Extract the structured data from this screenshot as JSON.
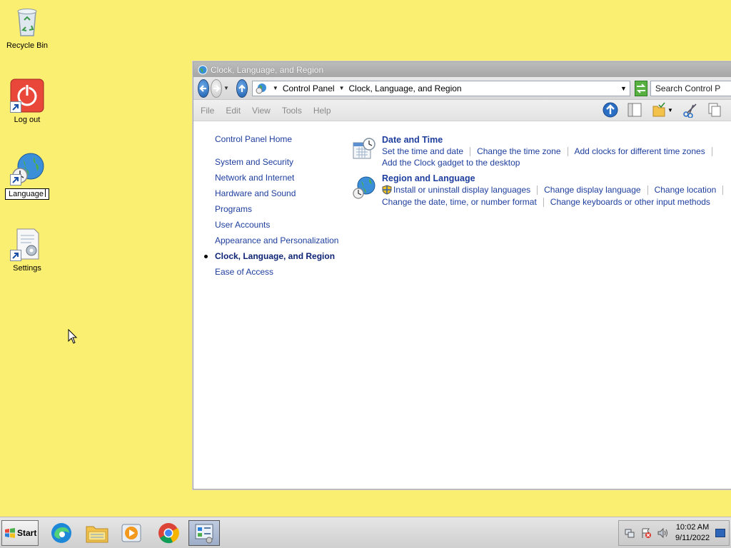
{
  "desktop": {
    "icons": [
      {
        "label": "Recycle Bin"
      },
      {
        "label": "Log out"
      },
      {
        "label": "Language"
      },
      {
        "label": "Settings"
      }
    ]
  },
  "window": {
    "title": "Clock, Language, and Region",
    "address": {
      "crumbs": [
        "Control Panel",
        "Clock, Language, and Region"
      ]
    },
    "search_placeholder": "Search Control P",
    "menu": [
      "File",
      "Edit",
      "View",
      "Tools",
      "Help"
    ],
    "sidebar": {
      "home": "Control Panel Home",
      "items": [
        "System and Security",
        "Network and Internet",
        "Hardware and Sound",
        "Programs",
        "User Accounts",
        "Appearance and Personalization",
        "Clock, Language, and Region",
        "Ease of Access"
      ],
      "current_index": 6
    },
    "categories": [
      {
        "title": "Date and Time",
        "icon": "calendar-clock-icon",
        "rows": [
          [
            "Set the time and date",
            "Change the time zone",
            "Add clocks for different time zones"
          ],
          [
            "Add the Clock gadget to the desktop"
          ]
        ]
      },
      {
        "title": "Region and Language",
        "icon": "globe-clock-icon",
        "rows": [
          [
            "Install or uninstall display languages",
            "Change display language",
            "Change location"
          ],
          [
            "Change the date, time, or number format",
            "Change keyboards or other input methods"
          ]
        ]
      }
    ]
  },
  "taskbar": {
    "start_label": "Start",
    "apps": [
      "edge-icon",
      "file-explorer-icon",
      "media-player-icon",
      "chrome-icon",
      "control-panel-icon"
    ],
    "clock": {
      "time": "10:02 AM",
      "date": "9/11/2022"
    }
  },
  "colors": {
    "desktop": "#FBEF72",
    "link": "#1E3E9E",
    "current_link": "#0E2475"
  }
}
